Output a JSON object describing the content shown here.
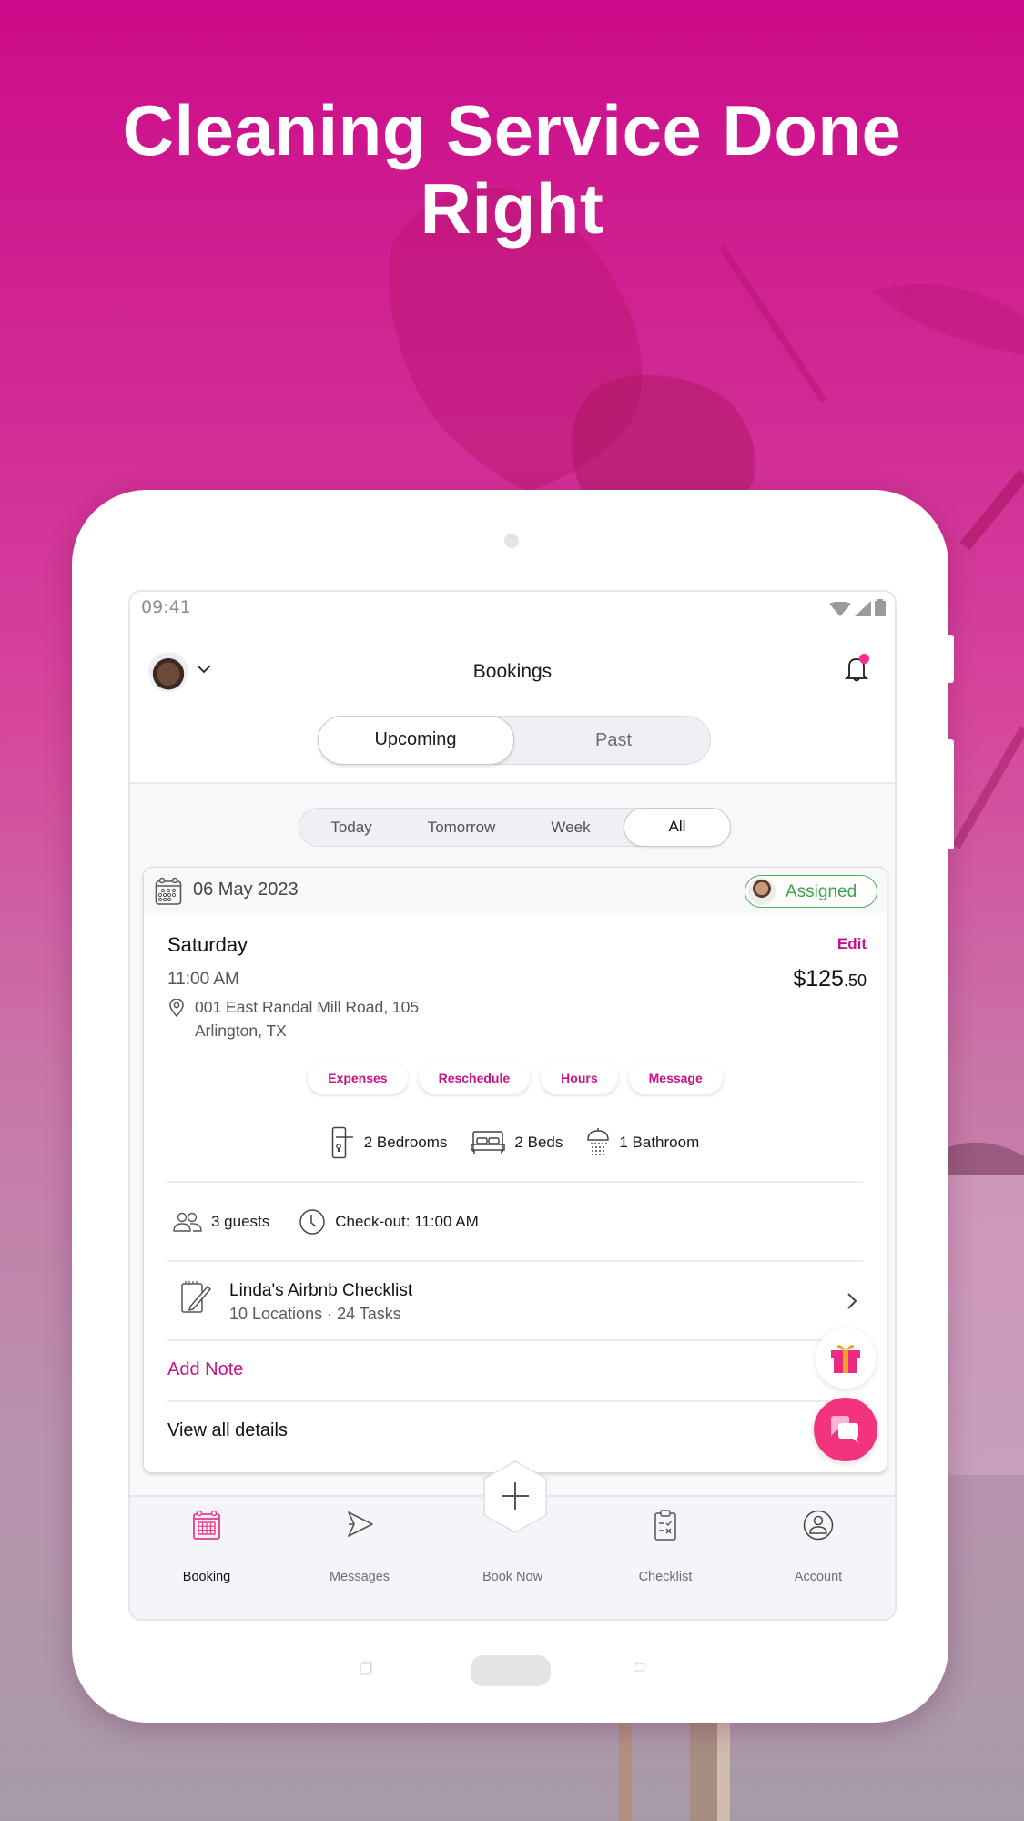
{
  "headline": {
    "line1": "Cleaning Service Done",
    "line2": "Right"
  },
  "status_bar": {
    "time": "09:41",
    "icons": [
      "wifi-icon",
      "signal-icon",
      "battery-icon"
    ]
  },
  "header": {
    "title": "Bookings",
    "avatar_icon": "user-avatar",
    "dropdown_icon": "chevron-down-icon",
    "notification_icon": "bell-icon",
    "has_unread_notification": true
  },
  "segments": {
    "items": [
      {
        "label": "Upcoming",
        "active": true
      },
      {
        "label": "Past",
        "active": false
      }
    ]
  },
  "filters": {
    "items": [
      {
        "label": "Today",
        "active": false
      },
      {
        "label": "Tomorrow",
        "active": false
      },
      {
        "label": "Week",
        "active": false
      },
      {
        "label": "All",
        "active": true
      }
    ]
  },
  "booking": {
    "date": "06 May 2023",
    "status": "Assigned",
    "day": "Saturday",
    "edit_label": "Edit",
    "time": "11:00 AM",
    "price_main": "$125",
    "price_cents": ".50",
    "address_line1": "001 East Randal Mill Road, 105",
    "address_line2": "Arlington, TX",
    "actions": [
      "Expenses",
      "Reschedule",
      "Hours",
      "Message"
    ],
    "amenities": [
      {
        "icon": "door-icon",
        "label": "2 Bedrooms"
      },
      {
        "icon": "bed-icon",
        "label": "2 Beds"
      },
      {
        "icon": "shower-icon",
        "label": "1 Bathroom"
      }
    ],
    "guests": "3 guests",
    "checkout": "Check-out: 11:00 AM",
    "checklist": {
      "title": "Linda's Airbnb Checklist",
      "subtitle": "10 Locations  ·  24 Tasks"
    },
    "add_note_label": "Add Note",
    "view_all_label": "View all details"
  },
  "fabs": {
    "gift_icon": "gift-icon",
    "chat_icon": "chat-icon"
  },
  "tabbar": {
    "items": [
      {
        "label": "Booking",
        "icon": "calendar-icon",
        "active": true
      },
      {
        "label": "Messages",
        "icon": "send-icon",
        "active": false
      },
      {
        "label": "Book Now",
        "icon": "plus-icon",
        "active": false
      },
      {
        "label": "Checklist",
        "icon": "clipboard-icon",
        "active": false
      },
      {
        "label": "Account",
        "icon": "account-icon",
        "active": false
      }
    ]
  },
  "colors": {
    "brand": "#c5138a",
    "accent_pink": "#f4337f",
    "assigned_green": "#3fa14a",
    "background_top": "#cc0b8a"
  }
}
